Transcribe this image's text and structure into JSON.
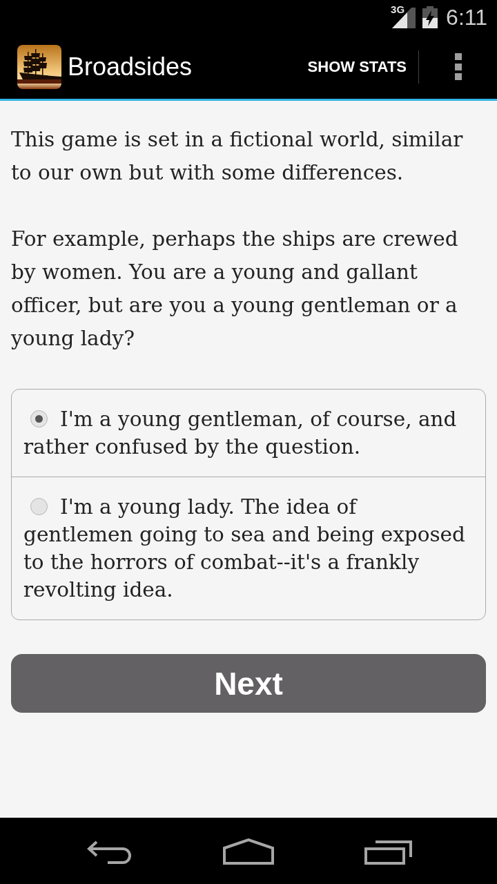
{
  "status_bar": {
    "network": "3G",
    "time": "6:11"
  },
  "action_bar": {
    "title": "Broadsides",
    "actions": [
      {
        "label": "SHOW STATS"
      }
    ]
  },
  "paragraphs": [
    "This game is set in a fictional world, similar to our own but with some differences.",
    "For example, perhaps the ships are crewed by women. You are a young and gallant officer, but are you a young gentleman or a young lady?"
  ],
  "choices": [
    {
      "text": "I'm a young gentleman, of course, and rather confused by the question.",
      "selected": true
    },
    {
      "text": "I'm a young lady. The idea of gentlemen going to sea and being exposed to the horrors of combat--it's a frankly revolting idea.",
      "selected": false
    }
  ],
  "next_button": {
    "label": "Next"
  }
}
